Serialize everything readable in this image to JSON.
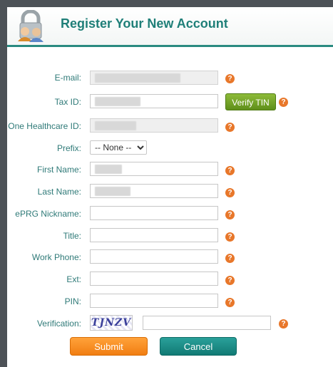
{
  "header": {
    "title": "Register Your New Account"
  },
  "form": {
    "email_label": "E-mail:",
    "taxid_label": "Tax ID:",
    "verify_tin": "Verify TIN",
    "ohid_label": "One Healthcare ID:",
    "prefix_label": "Prefix:",
    "prefix_value": "-- None --",
    "first_label": "First Name:",
    "last_label": "Last Name:",
    "nick_label": "ePRG Nickname:",
    "title_label": "Title:",
    "phone_label": "Work Phone:",
    "ext_label": "Ext:",
    "pin_label": "PIN:",
    "verif_label": "Verification:",
    "captcha_text": "TJNZV",
    "help_glyph": "?"
  },
  "buttons": {
    "submit": "Submit",
    "cancel": "Cancel"
  },
  "colors": {
    "accent": "#1f7f78",
    "help": "#e8772a",
    "verify": "#6a9a22",
    "submit": "#f5891c",
    "cancel": "#1b8a84"
  }
}
